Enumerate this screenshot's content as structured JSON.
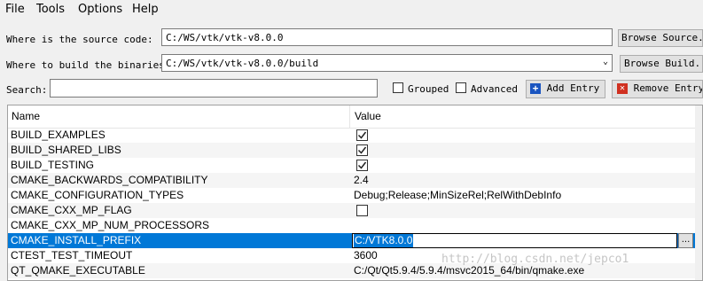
{
  "menu": {
    "file": "File",
    "tools": "Tools",
    "options": "Options",
    "help": "Help"
  },
  "form": {
    "source_label": "Where is the source code:",
    "source_value": "C:/WS/vtk/vtk-v8.0.0",
    "browse_source": "Browse Source...",
    "build_label": "Where to build the binaries:",
    "build_value": "C:/WS/vtk/vtk-v8.0.0/build",
    "browse_build": "Browse Build...",
    "search_label": "Search:",
    "search_value": "",
    "grouped_label": "Grouped",
    "grouped_checked": false,
    "advanced_label": "Advanced",
    "advanced_checked": false,
    "add_entry": "Add Entry",
    "remove_entry": "Remove Entry"
  },
  "table": {
    "col_name": "Name",
    "col_value": "Value",
    "rows": [
      {
        "name": "BUILD_EXAMPLES",
        "value": "",
        "checkbox": true,
        "checked": true
      },
      {
        "name": "BUILD_SHARED_LIBS",
        "value": "",
        "checkbox": true,
        "checked": true
      },
      {
        "name": "BUILD_TESTING",
        "value": "",
        "checkbox": true,
        "checked": true
      },
      {
        "name": "CMAKE_BACKWARDS_COMPATIBILITY",
        "value": "2.4"
      },
      {
        "name": "CMAKE_CONFIGURATION_TYPES",
        "value": "Debug;Release;MinSizeRel;RelWithDebInfo"
      },
      {
        "name": "CMAKE_CXX_MP_FLAG",
        "value": "",
        "checkbox": true,
        "checked": false
      },
      {
        "name": "CMAKE_CXX_MP_NUM_PROCESSORS",
        "value": ""
      },
      {
        "name": "CMAKE_INSTALL_PREFIX",
        "value": "C:/VTK8.0.0",
        "selected": true
      },
      {
        "name": "CTEST_TEST_TIMEOUT",
        "value": "3600"
      },
      {
        "name": "QT_QMAKE_EXECUTABLE",
        "value": "C:/Qt/Qt5.9.4/5.9.4/msvc2015_64/bin/qmake.exe"
      }
    ],
    "edit_browse": "..."
  },
  "watermark": "http://blog.csdn.net/jepco1",
  "colors": {
    "selection": "#0078d7",
    "add_icon": "#1a55c0",
    "remove_icon": "#d03020"
  }
}
